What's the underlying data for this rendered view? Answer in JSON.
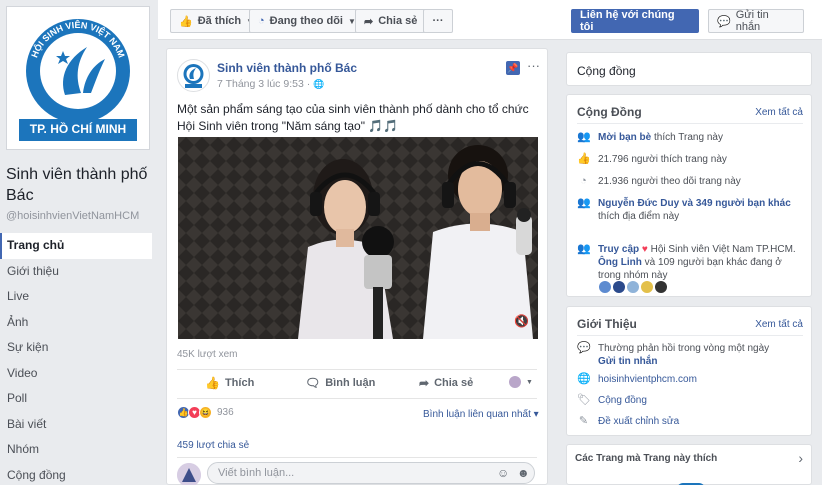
{
  "page": {
    "name": "Sinh viên thành phố Bác",
    "handle": "@hoisinhvienVietNamHCM",
    "logo_text_top": "HỘI SINH VIÊN VIỆT NAM",
    "logo_text_bottom": "TP. HỒ CHÍ MINH"
  },
  "nav": [
    "Trang chủ",
    "Giới thiệu",
    "Live",
    "Ảnh",
    "Sự kiện",
    "Video",
    "Poll",
    "Bài viết",
    "Nhóm",
    "Cộng đồng"
  ],
  "actionbar": {
    "liked": "Đã thích",
    "following": "Đang theo dõi",
    "share": "Chia sẻ",
    "more": "···",
    "contact": "Liên hệ với chúng tôi",
    "message": "Gửi tin nhắn"
  },
  "post": {
    "author": "Sinh viên thành phố Bác",
    "time": "7 Tháng 3 lúc 9:53 ·",
    "text": "Một sản phẩm sáng tạo của sinh viên thành phố dành cho tổ chức Hội Sinh viên trong \"Năm sáng tạo\" 🎵🎵",
    "views": "45K lượt xem",
    "actions": {
      "like": "Thích",
      "comment": "Bình luận",
      "share": "Chia sẻ"
    },
    "reactions_count": "936",
    "sort": "Bình luận liên quan nhất ▾",
    "shares": "459 lượt chia sẻ",
    "comment_placeholder": "Viết bình luận..."
  },
  "right": {
    "category": "Cộng đồng",
    "community": {
      "title": "Cộng Đồng",
      "see_all": "Xem tất cả",
      "invite": "Mời bạn bè",
      "invite_rest": " thích Trang này",
      "likes": "21.796 người thích trang này",
      "follows": "21.936 người theo dõi trang này",
      "friends_link": "Nguyễn Đức Duy và 349 người bạn khác",
      "friends_rest": "thích địa điểm này",
      "visit_a": "Truy cập",
      "visit_b": " Hội Sinh viên Việt Nam TP.HCM.",
      "visit_c": "Ông Linh",
      "visit_d": " và 109 người bạn khác đang ở trong nhóm này"
    },
    "about": {
      "title": "Giới Thiệu",
      "see_all": "Xem tất cả",
      "response": "Thường phản hồi trong vòng một ngày",
      "send_msg": "Gửi tin nhắn",
      "website": "hoisinhvientphcm.com",
      "category": "Cộng đồng",
      "suggest": "Đề xuất chỉnh sửa"
    },
    "liked_pages": "Các Trang mà Trang này thích"
  },
  "colors": {
    "brand": "#4267b2",
    "link": "#365899",
    "logo_blue": "#1c75bc"
  }
}
